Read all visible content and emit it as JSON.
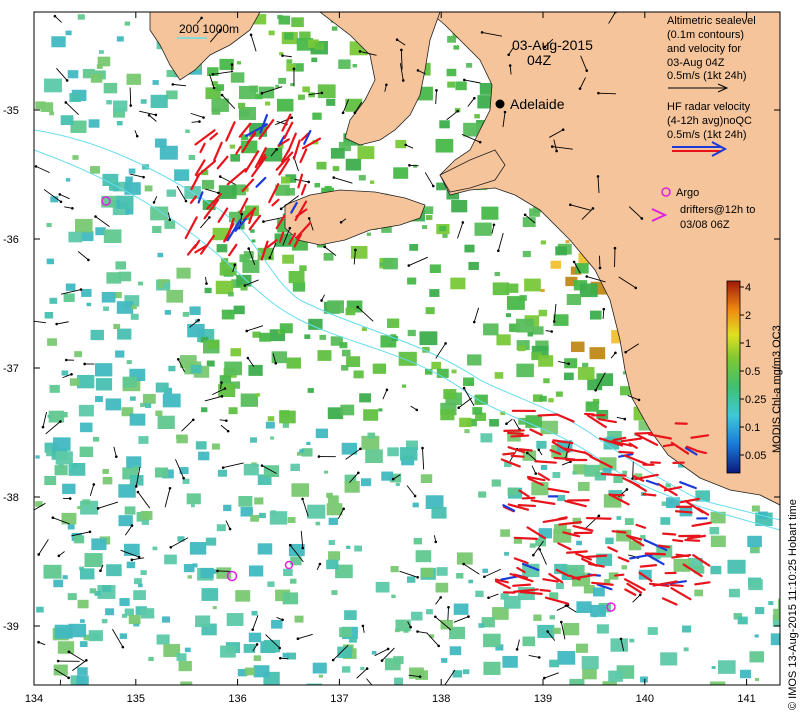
{
  "map": {
    "date_label": "03-Aug-2015",
    "time_label": "04Z",
    "city": "Adelaide",
    "scale_bar_label": "200  1000m",
    "legend_sealevel": [
      "Altimetric sealevel",
      "(0.1m contours)",
      "and velocity for",
      "03-Aug 04Z",
      "0.5m/s (1kt 24h)"
    ],
    "legend_radar": [
      "HF radar velocity",
      "(4-12h avg)noQC",
      "0.5m/s (1kt 24h)"
    ],
    "legend_argo": "Argo",
    "legend_drifters": [
      "drifters@12h to",
      "03/08 06Z"
    ],
    "colorbar_title": "MODIS Chl-a mg/m3 OC3",
    "colorbar_ticks": [
      "4",
      "2",
      "1",
      "0.5",
      "0.25",
      "0.1",
      "0.05"
    ],
    "credit": "© IMOS 13-Aug-2015 11:10:25 Hobart time",
    "x_ticks": [
      "134",
      "135",
      "136",
      "137",
      "138",
      "139",
      "140",
      "141"
    ],
    "y_ticks": [
      "-35",
      "-36",
      "-37",
      "-38",
      "-39"
    ],
    "colors": {
      "land": "#f5c49a",
      "radar_red": "#e8141c",
      "radar_blue": "#1c3ad8",
      "argo": "#e020e0",
      "contour": "#66ddee"
    }
  }
}
